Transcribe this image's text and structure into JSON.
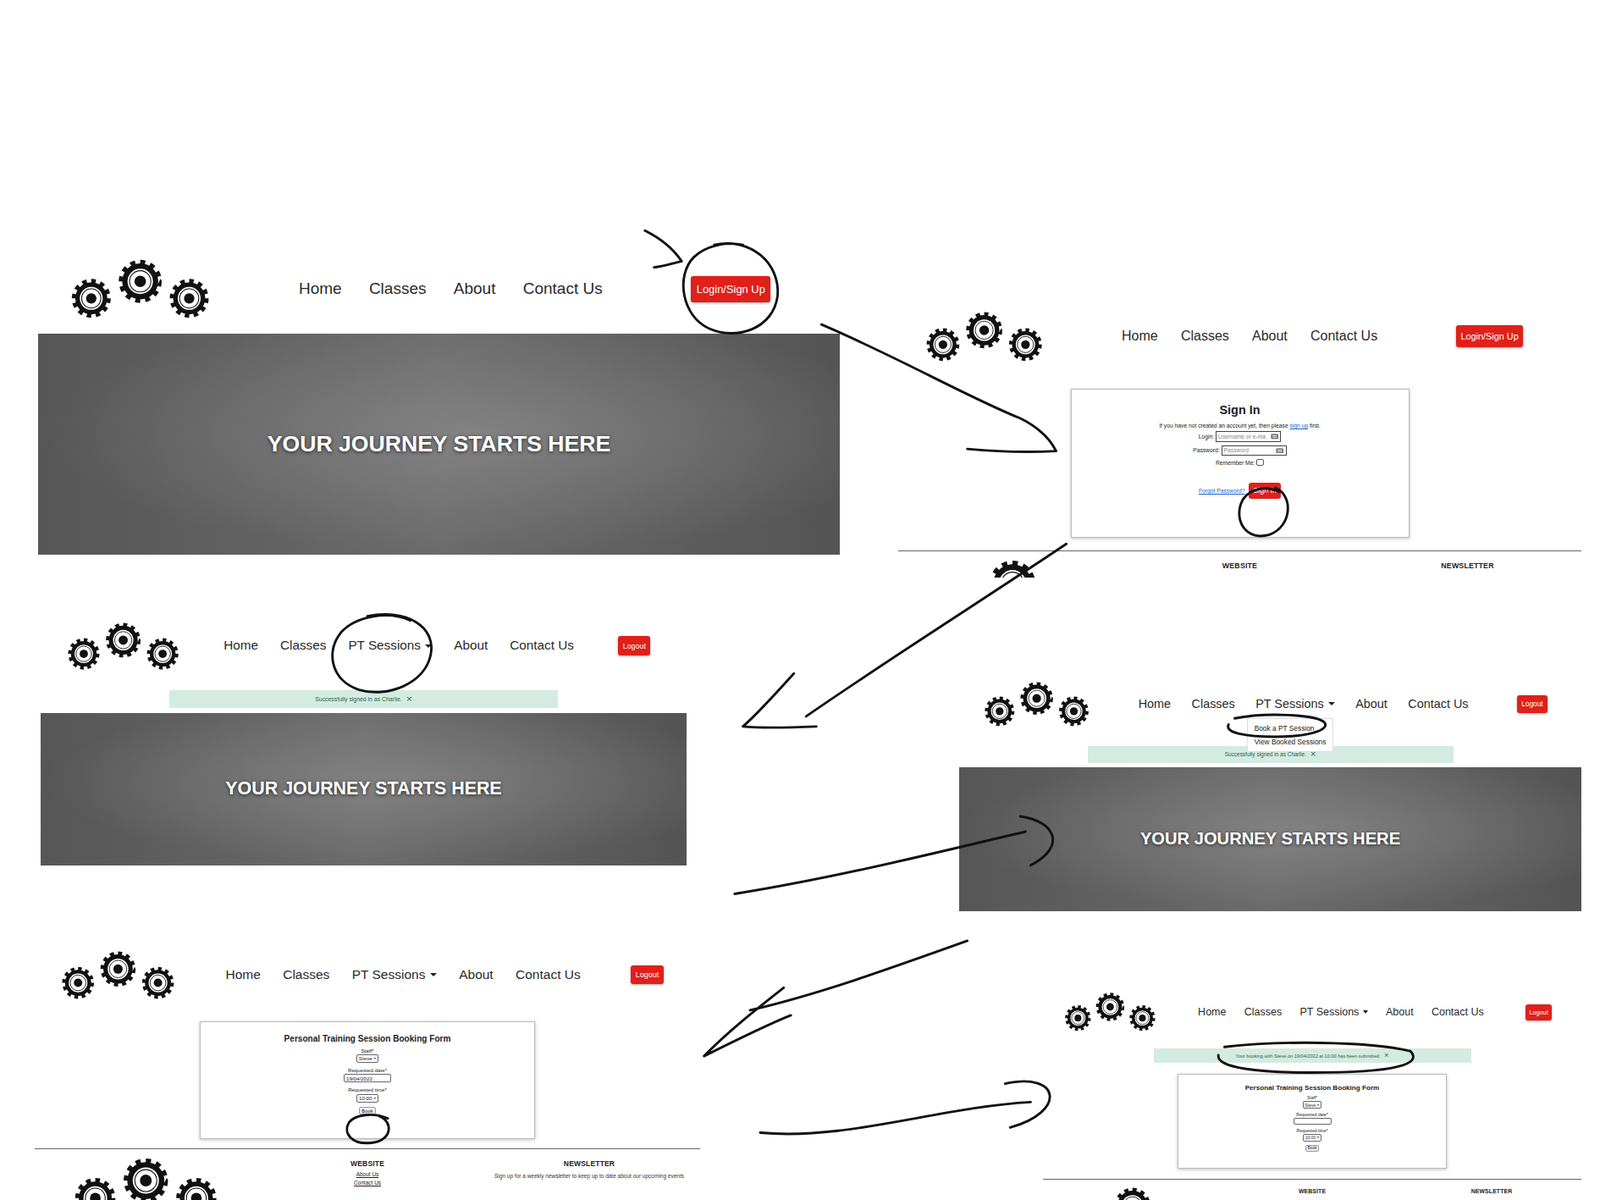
{
  "screens": [
    {
      "signed_in": false,
      "nav": [
        {
          "label": "Home",
          "dropdown": false,
          "expanded": false
        },
        {
          "label": "Classes",
          "dropdown": false,
          "expanded": false
        },
        {
          "label": "About",
          "dropdown": false,
          "expanded": false
        },
        {
          "label": "Contact Us",
          "dropdown": false,
          "expanded": false
        }
      ],
      "auth_button": "Login/Sign Up",
      "hero": {
        "heading": "YOUR JOURNEY STARTS HERE"
      }
    },
    {
      "signed_in": false,
      "nav": [
        {
          "label": "Home",
          "dropdown": false,
          "expanded": false
        },
        {
          "label": "Classes",
          "dropdown": false,
          "expanded": false
        },
        {
          "label": "About",
          "dropdown": false,
          "expanded": false
        },
        {
          "label": "Contact Us",
          "dropdown": false,
          "expanded": false
        }
      ],
      "auth_button": "Login/Sign Up",
      "sign_in": {
        "title": "Sign In",
        "intro": "If you have not created an account yet, then please",
        "intro_link": "sign up",
        "intro_end": "first.",
        "fields": [
          {
            "label": "Login:",
            "placeholder": "Username or e-ma"
          },
          {
            "label": "Password:",
            "placeholder": "Password"
          }
        ],
        "remember": {
          "label": "Remember Me:",
          "checked": false
        },
        "forgot": "Forgot Password?",
        "submit": "Sign In"
      },
      "footer": {
        "website": {
          "heading": "WEBSITE",
          "links": []
        },
        "newsletter": {
          "heading": "NEWSLETTER"
        }
      }
    },
    {
      "signed_in": true,
      "nav": [
        {
          "label": "Home",
          "dropdown": false,
          "expanded": false
        },
        {
          "label": "Classes",
          "dropdown": false,
          "expanded": false
        },
        {
          "label": "PT Sessions",
          "dropdown": true,
          "expanded": false
        },
        {
          "label": "About",
          "dropdown": false,
          "expanded": false
        },
        {
          "label": "Contact Us",
          "dropdown": false,
          "expanded": false
        }
      ],
      "auth_button": "Logout",
      "alert": {
        "text": "Successfully signed in as Charlie.",
        "close": "×"
      },
      "hero": {
        "heading": "YOUR JOURNEY STARTS HERE"
      }
    },
    {
      "signed_in": true,
      "nav": [
        {
          "label": "Home",
          "dropdown": false,
          "expanded": false
        },
        {
          "label": "Classes",
          "dropdown": false,
          "expanded": false
        },
        {
          "label": "PT Sessions",
          "dropdown": true,
          "expanded": true,
          "menu": [
            "Book a PT Session",
            "View Booked Sessions"
          ]
        },
        {
          "label": "About",
          "dropdown": false,
          "expanded": false
        },
        {
          "label": "Contact Us",
          "dropdown": false,
          "expanded": false
        }
      ],
      "auth_button": "Logout",
      "alert": {
        "text": "Successfully signed in as Charlie.",
        "close": "×"
      },
      "hero": {
        "heading": "YOUR JOURNEY STARTS HERE"
      }
    },
    {
      "signed_in": true,
      "nav": [
        {
          "label": "Home",
          "dropdown": false,
          "expanded": false
        },
        {
          "label": "Classes",
          "dropdown": false,
          "expanded": false
        },
        {
          "label": "PT Sessions",
          "dropdown": true,
          "expanded": false
        },
        {
          "label": "About",
          "dropdown": false,
          "expanded": false
        },
        {
          "label": "Contact Us",
          "dropdown": false,
          "expanded": false
        }
      ],
      "auth_button": "Logout",
      "booking_form": {
        "title": "Personal Training Session Booking Form",
        "fields": [
          {
            "label": "Staff*",
            "kind": "select",
            "value": "Steve"
          },
          {
            "label": "Requested date*",
            "kind": "text",
            "value": "19/04/2022"
          },
          {
            "label": "Requested time*",
            "kind": "select",
            "value": "10:00"
          }
        ],
        "submit": "Book"
      },
      "footer": {
        "website": {
          "heading": "WEBSITE",
          "links": [
            "About Us",
            "Contact Us"
          ]
        },
        "newsletter": {
          "heading": "NEWSLETTER",
          "text": "Sign up for a weekly newsletter to keep up to date about our upcoming events"
        }
      }
    },
    {
      "signed_in": true,
      "nav": [
        {
          "label": "Home",
          "dropdown": false,
          "expanded": false
        },
        {
          "label": "Classes",
          "dropdown": false,
          "expanded": false
        },
        {
          "label": "PT Sessions",
          "dropdown": true,
          "expanded": false
        },
        {
          "label": "About",
          "dropdown": false,
          "expanded": false
        },
        {
          "label": "Contact Us",
          "dropdown": false,
          "expanded": false
        }
      ],
      "auth_button": "Logout",
      "alert": {
        "text": "Your booking with Steve on 19/04/2022 at 10:00 has been submitted.",
        "close": "×"
      },
      "booking_form": {
        "title": "Personal Training Session Booking Form",
        "fields": [
          {
            "label": "Staff*",
            "kind": "select",
            "value": "Steve"
          },
          {
            "label": "Requested date*",
            "kind": "text",
            "value": ""
          },
          {
            "label": "Requested time*",
            "kind": "select",
            "value": "10:00"
          }
        ],
        "submit": "Book"
      },
      "footer": {
        "website": {
          "heading": "WEBSITE",
          "links": []
        },
        "newsletter": {
          "heading": "NEWSLETTER"
        }
      }
    }
  ]
}
